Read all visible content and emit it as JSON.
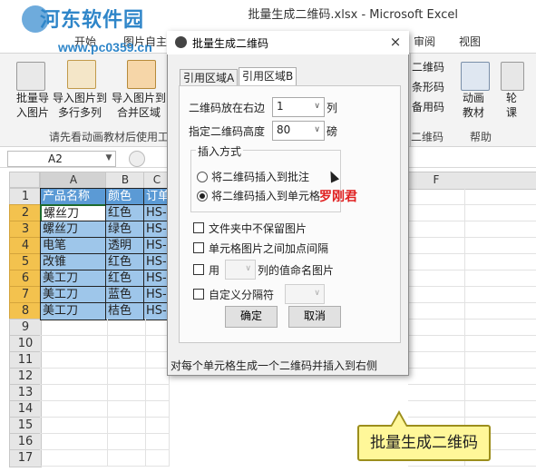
{
  "window": {
    "title": "批量生成二维码.xlsx - Microsoft Excel"
  },
  "watermark": {
    "site_name": "河东软件园",
    "url": "www.pc0359.cn"
  },
  "ribbon": {
    "tabs": [
      "开始",
      "图片自主",
      "审阅",
      "视图"
    ],
    "buttons": [
      {
        "label": "批量导入图片",
        "line1": "批量导",
        "line2": "入图片"
      },
      {
        "label": "导入图片到多行多列",
        "line1": "导入图片到",
        "line2": "多行多列"
      },
      {
        "label": "导入图片到合并区域",
        "line1": "导入图片到",
        "line2": "合并区域"
      }
    ],
    "right_items": [
      "二维码",
      "条形码",
      "备用码",
      "二维码"
    ],
    "right_buttons": [
      {
        "line1": "动画",
        "line2": "教材"
      },
      {
        "line1": "轮",
        "line2": "课"
      }
    ],
    "group_hint": "请先看动画教材后使用工",
    "help_group": "帮助"
  },
  "formula_bar": {
    "name_box": "A2"
  },
  "columns": [
    "A",
    "B",
    "C",
    "F"
  ],
  "rows": [
    "1",
    "2",
    "3",
    "4",
    "5",
    "6",
    "7",
    "8",
    "9",
    "10",
    "11",
    "12",
    "13",
    "14",
    "15",
    "16",
    "17"
  ],
  "table": {
    "headers": [
      "产品名称",
      "颜色",
      "订单"
    ],
    "records": [
      [
        "螺丝刀",
        "红色",
        "HS-"
      ],
      [
        "螺丝刀",
        "绿色",
        "HS-"
      ],
      [
        "电笔",
        "透明",
        "HS-"
      ],
      [
        "改锥",
        "红色",
        "HS-"
      ],
      [
        "美工刀",
        "红色",
        "HS-"
      ],
      [
        "美工刀",
        "蓝色",
        "HS-"
      ],
      [
        "美工刀",
        "桔色",
        "HS-"
      ]
    ]
  },
  "dialog": {
    "title": "批量生成二维码",
    "close": "×",
    "tabs": [
      "引用区域A",
      "引用区域B"
    ],
    "active_tab": "引用区域B",
    "placement_label": "二维码放在右边",
    "placement_value": "1",
    "placement_unit": "列",
    "height_label": "指定二维码高度",
    "height_value": "80",
    "height_unit": "磅",
    "insert_group": "插入方式",
    "insert_options": [
      "将二维码插入到批注",
      "将二维码插入到单元格"
    ],
    "insert_selected_index": 1,
    "author_sign": "罗刚君",
    "checkboxes": [
      "文件夹中不保留图片",
      "单元格图片之间加点间隔",
      "用",
      "自定义分隔符"
    ],
    "use_column_suffix": "列的值命名图片",
    "ok": "确定",
    "cancel": "取消",
    "status": "对每个单元格生成一个二维码并插入到右侧"
  },
  "callout": {
    "text": "批量生成二维码"
  },
  "colors": {
    "accent": "#2f86c9",
    "selection_row": "#f3c24e",
    "table_fill": "#9ec6ea",
    "callout": "#fff799"
  }
}
